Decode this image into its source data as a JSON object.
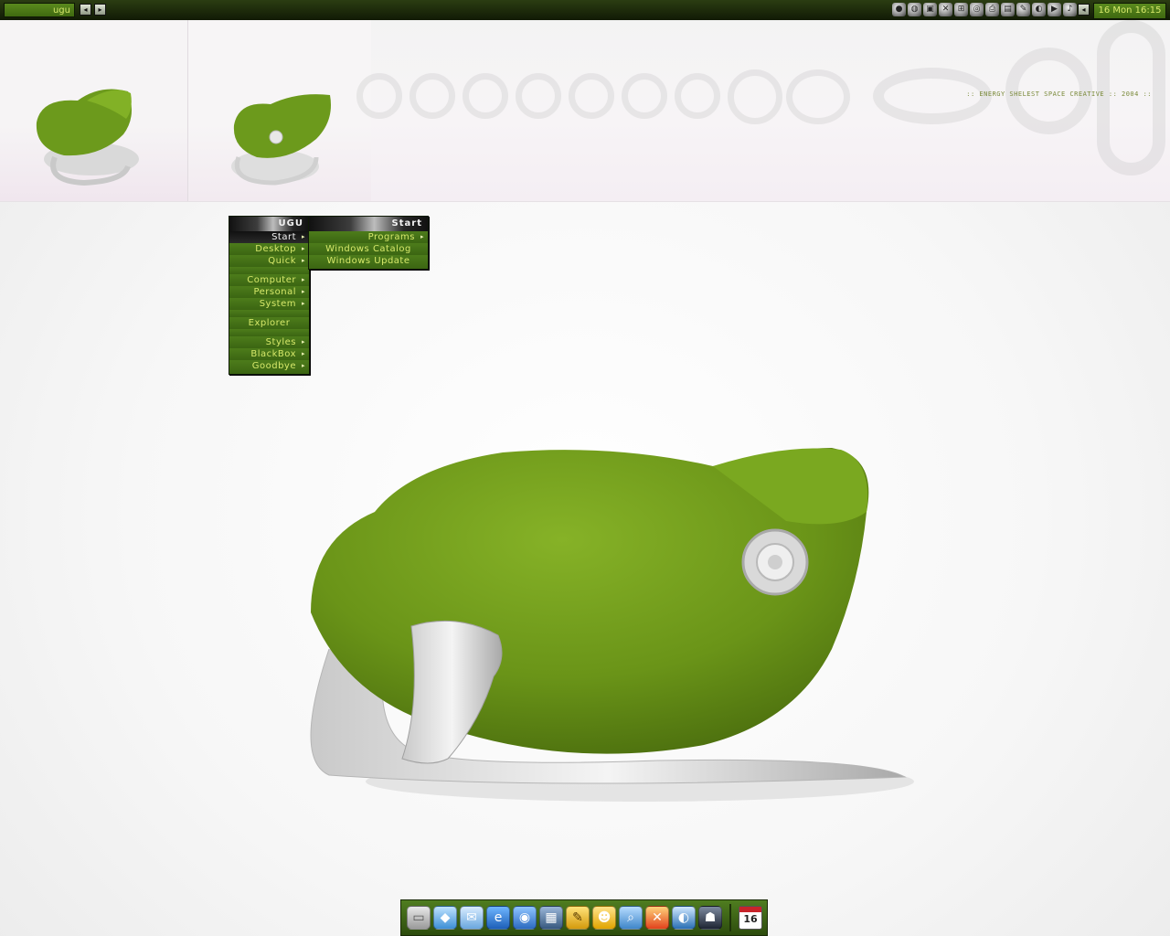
{
  "toolbar": {
    "workspace_label": "ugu",
    "prev_button": "◂",
    "next_button": "▸",
    "clock": "16 Mon 16:15",
    "tray_icons": [
      "dot-icon",
      "globe-icon",
      "display-icon",
      "x-icon",
      "network-icon",
      "cd-icon",
      "printer-icon",
      "monitor-icon",
      "tools-icon",
      "firefox-icon",
      "media-icon",
      "sound-icon"
    ],
    "tray_prev": "◂",
    "tray_next": "▸"
  },
  "banner": {
    "credit": ":: ENERGY SHELEST SPACE CREATIVE :: 2004 ::"
  },
  "root_menu": {
    "title": "UGU",
    "items": [
      {
        "label": "Start",
        "submenu": true,
        "active": true
      },
      {
        "label": "Desktop",
        "submenu": true
      },
      {
        "label": "Quick",
        "submenu": true
      },
      {
        "label": "Computer",
        "submenu": true
      },
      {
        "label": "Personal",
        "submenu": true
      },
      {
        "label": "System",
        "submenu": true
      },
      {
        "label": "Explorer",
        "submenu": false
      },
      {
        "label": "Styles",
        "submenu": true
      },
      {
        "label": "BlackBox",
        "submenu": true
      },
      {
        "label": "Goodbye",
        "submenu": true
      }
    ]
  },
  "start_menu": {
    "title": "Start",
    "items": [
      {
        "label": "Programs",
        "submenu": true
      },
      {
        "label": "Windows Catalog",
        "submenu": false
      },
      {
        "label": "Windows Update",
        "submenu": false
      }
    ]
  },
  "dock": {
    "icons": [
      "hard-drive-icon",
      "finder-icon",
      "mail-icon",
      "internet-explorer-icon",
      "browser-icon",
      "photo-icon",
      "notes-icon",
      "messenger-icon",
      "search-icon",
      "tools-icon",
      "media-player-icon",
      "game-icon"
    ],
    "calendar_day": "16"
  },
  "colors": {
    "accent": "#4d7c1b",
    "menu_text": "#d6e86a",
    "toolbar_bg": "#1c2a09"
  }
}
